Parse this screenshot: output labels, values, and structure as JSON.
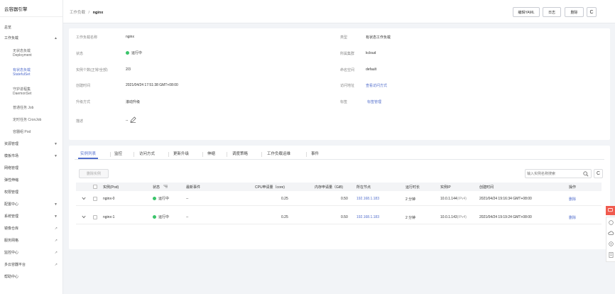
{
  "sidebar": {
    "title": "云容器引擎",
    "items": [
      {
        "label": "总览"
      },
      {
        "label": "工作负载",
        "arrow": "▲"
      },
      {
        "label": "无状态负载",
        "sub": "Deployment"
      },
      {
        "label": "有状态负载",
        "sub": "StatefulSet"
      },
      {
        "label": "守护进程集",
        "sub": "DaemonSet"
      },
      {
        "label": "普通任务 Job"
      },
      {
        "label": "定时任务 CronJob"
      },
      {
        "label": "容器组 Pod"
      },
      {
        "label": "资源管理",
        "arrow": "▼"
      },
      {
        "label": "模板市场",
        "arrow": "▼"
      },
      {
        "label": "网络管理"
      },
      {
        "label": "弹性伸缩"
      },
      {
        "label": "权限管理"
      },
      {
        "label": "配置中心",
        "arrow": "▼"
      },
      {
        "label": "系统管理",
        "arrow": "▼"
      },
      {
        "label": "镜像仓库",
        "arrow": "↗"
      },
      {
        "label": "服务网格",
        "arrow": "↗"
      },
      {
        "label": "监控中心",
        "arrow": "↗"
      },
      {
        "label": "多云容器平台",
        "arrow": "↗"
      },
      {
        "label": "帮助中心"
      }
    ]
  },
  "header": {
    "breadcrumb_parent": "工作负载",
    "breadcrumb_sep": "/",
    "breadcrumb_current": "nginx",
    "buttons": {
      "yaml": "编辑YAML",
      "log": "日志",
      "delete": "删除",
      "refresh": "C"
    }
  },
  "info": {
    "name_label": "工作负载名称",
    "name": "nginx",
    "type_label": "类型",
    "type": "有状态工作负载",
    "status_label": "状态",
    "status": "运行中",
    "cluster_label": "所属集群",
    "cluster": "kcloud",
    "instances_label": "实例个数(正常/全部)",
    "instances": "2/3",
    "namespace_label": "命名空间",
    "namespace": "default",
    "created_label": "创建时间",
    "created": "2021/04/24 17:51:38 GMT+08:00",
    "access_label": "访问地址",
    "access": "查看访问方式",
    "upgrade_label": "升级方式",
    "upgrade": "滚动升级",
    "tag_label": "标签",
    "tag": "标签管理",
    "desc_label": "描述",
    "desc": "--"
  },
  "tabs": [
    "实例列表",
    "监控",
    "访问方式",
    "更新升级",
    "伸缩",
    "调度策略",
    "工作负载运维",
    "事件"
  ],
  "pods": {
    "delete_button": "删除实例",
    "search_placeholder": "输入实例名称搜索",
    "columns": {
      "name": "实例(Pod)",
      "status": "状态",
      "event": "最新事件",
      "cpu": "CPU申请量（core)",
      "mem": "内存申请量（GiB)",
      "node": "所在节点",
      "runtime": "运行时长",
      "ip": "实例IP",
      "created": "创建时间",
      "action": "操作"
    },
    "rows": [
      {
        "name": "nginx-0",
        "status": "运行中",
        "event": "--",
        "cpu": "0.25",
        "mem": "0.50",
        "node": "192.168.1.183",
        "runtime": "2 分钟",
        "ip": "10.0.1.144",
        "ip_tag": "(IPv4)",
        "created": "2021/04/24 19:16:34 GMT+08:00",
        "action": "删除"
      },
      {
        "name": "nginx-1",
        "status": "运行中",
        "event": "--",
        "cpu": "0.25",
        "mem": "0.50",
        "node": "192.168.1.183",
        "runtime": "2 分钟",
        "ip": "10.0.1.143",
        "ip_tag": "(IPv4)",
        "created": "2021/04/24 19:19:24 GMT+08:00",
        "action": "删除"
      }
    ]
  },
  "colors": {
    "accent": "#526ecc",
    "running": "#3ac46a",
    "float_red": "#f05a4e"
  }
}
